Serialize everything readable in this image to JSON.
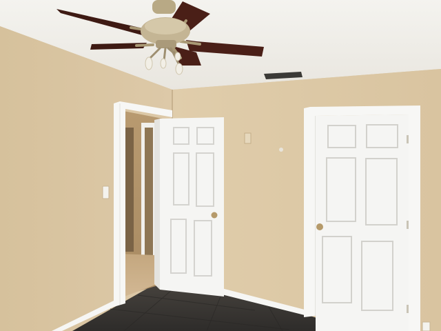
{
  "scene": {
    "colors": {
      "ceiling": "#f3f1ec",
      "wall_left": "#d8c4a2",
      "wall_back": "#ddcaa8",
      "floor": "#3a3835",
      "trim": "#f7f7f5",
      "door": "#f4f4f2",
      "door_panel_shadow": "#d8d8d4",
      "fan_blade": "#4a1f17",
      "fan_metal": "#b9ab8e",
      "hallway_wall": "#c9ae86",
      "hallway_floor": "#c6a982"
    },
    "icons": {
      "ceiling_fan": "ceiling-fan-icon",
      "ac_vent": "vent-icon",
      "light_switch": "light-switch-icon",
      "door_knob": "doorknob-icon"
    }
  }
}
